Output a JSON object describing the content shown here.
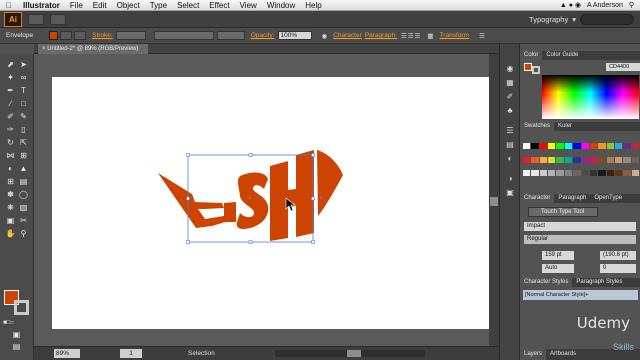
{
  "menubar": {
    "app": "Illustrator",
    "items": [
      "File",
      "Edit",
      "Object",
      "Type",
      "Select",
      "Effect",
      "View",
      "Window",
      "Help"
    ],
    "user": "A Anderson"
  },
  "appbar": {
    "logo": "Ai",
    "workspace": "Typography"
  },
  "control": {
    "mode": "Envelope",
    "stroke_label": "Stroke:",
    "opacity_label": "Opacity:",
    "opacity_value": "100%",
    "character_link": "Character",
    "paragraph_link": "Paragraph:",
    "transform_link": "Transform"
  },
  "document": {
    "tab_title": "Untitled-2* @ 89% (RGB/Preview)"
  },
  "artwork": {
    "text": "FISH",
    "color": "#cd4400"
  },
  "statusbar": {
    "zoom": "89%",
    "page": "1",
    "tool": "Selection"
  },
  "panels": {
    "color": {
      "tabs": [
        "Color",
        "Color Guide"
      ],
      "hex": "CD4400"
    },
    "swatches": {
      "tabs": [
        "Swatches",
        "Kuler"
      ]
    },
    "character": {
      "tabs": [
        "Character",
        "Paragraph",
        "OpenType"
      ],
      "touch_type": "Touch Type Tool",
      "font": "Impact",
      "style": "Regular",
      "size": "159 pt",
      "leading": "(190.8 pt)",
      "kerning": "Auto",
      "tracking": "0"
    },
    "character_styles": {
      "tabs": [
        "Character Styles",
        "Paragraph Styles"
      ],
      "item": "[Normal Character Style]+"
    },
    "bottom_tabs": [
      "Layers",
      "Artboards"
    ]
  },
  "watermarks": {
    "udemy": "Udemy",
    "lynda": "Skills"
  },
  "tools": [
    "selection",
    "direct-selection",
    "magic-wand",
    "lasso",
    "pen",
    "type",
    "line",
    "rectangle",
    "paintbrush",
    "pencil",
    "blob-brush",
    "eraser",
    "rotate",
    "scale",
    "width",
    "free-transform",
    "shape-builder",
    "perspective",
    "mesh",
    "gradient",
    "eyedropper",
    "blend",
    "symbol-sprayer",
    "column-graph",
    "artboard",
    "slice",
    "hand",
    "zoom"
  ]
}
